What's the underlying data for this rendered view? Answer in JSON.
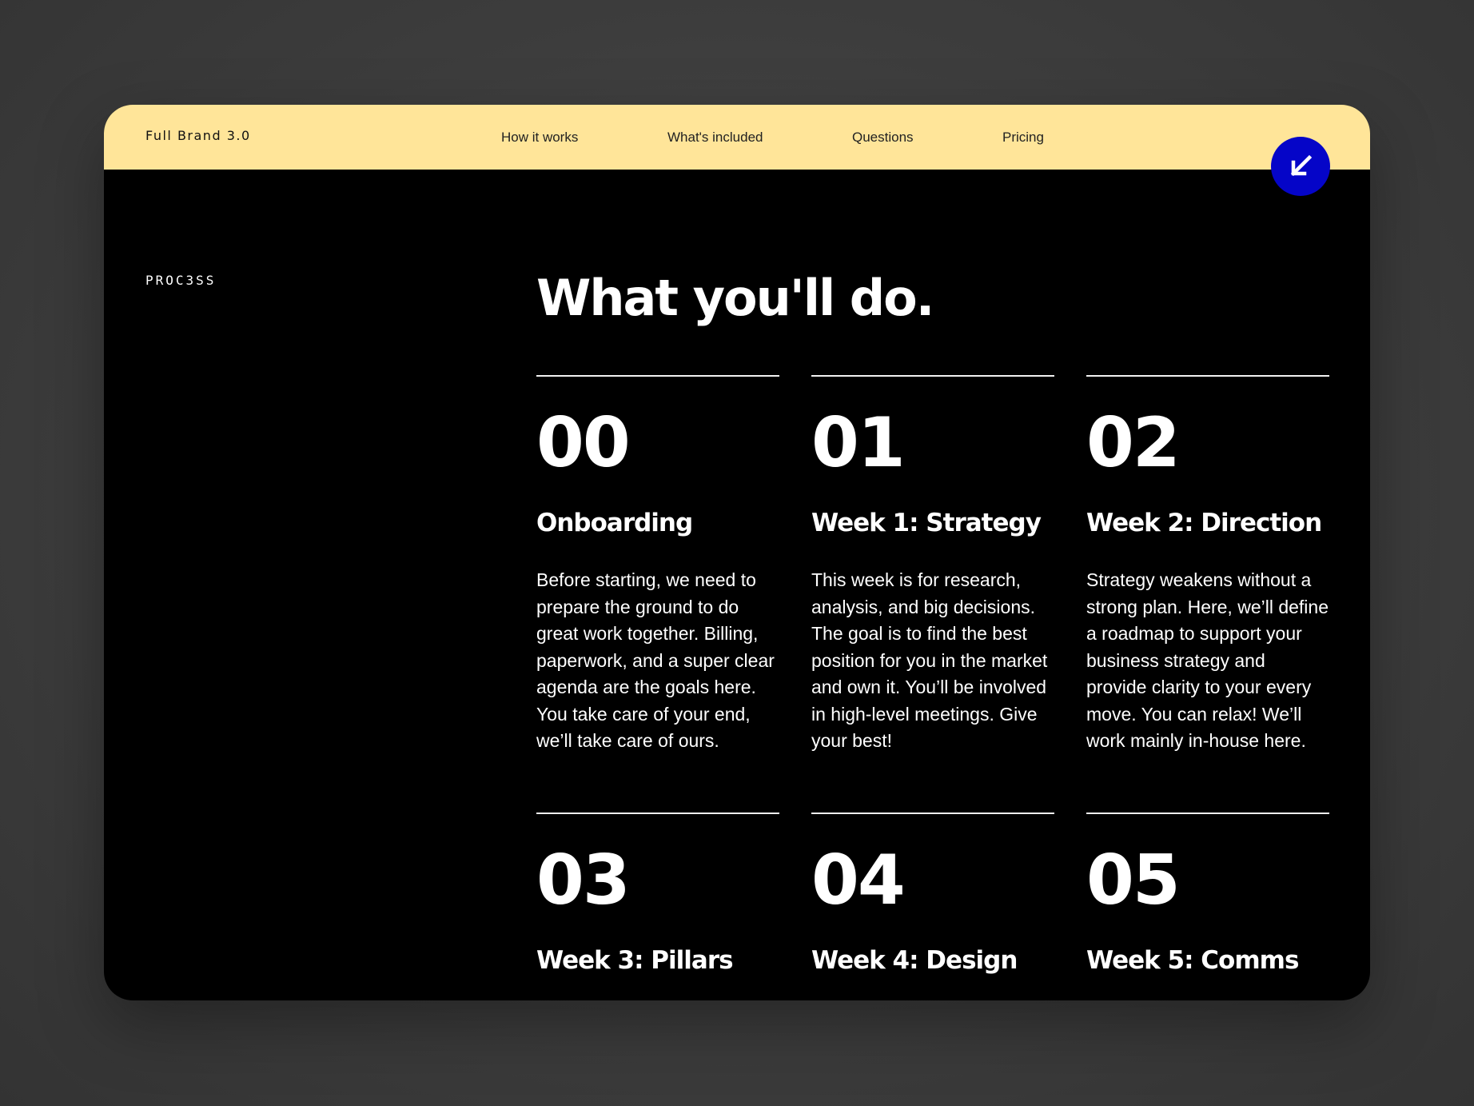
{
  "header": {
    "brand": "Full Brand 3.0",
    "nav": [
      {
        "label": "How it works"
      },
      {
        "label": "What's included"
      },
      {
        "label": "Questions"
      },
      {
        "label": "Pricing"
      }
    ],
    "fab_icon": "arrow-down-left-icon"
  },
  "section": {
    "label": "PROC3SS",
    "headline": "What you'll do."
  },
  "steps": [
    {
      "number": "00",
      "title": "Onboarding",
      "description": "Before starting, we need to prepare the ground to do great work together. Billing, paperwork, and a super clear agenda are the goals here. You take care of your end, we’ll take care of ours."
    },
    {
      "number": "01",
      "title": "Week 1: Strategy",
      "description": "This week is for research, analysis, and big decisions. The goal is to find the best position for you in the market and own it. You’ll be involved in high-level meetings. Give your best!"
    },
    {
      "number": "02",
      "title": "Week 2: Direction",
      "description": "Strategy weakens without a strong plan. Here, we’ll define a roadmap to support your business strategy and provide clarity to your every move. You can relax! We’ll work mainly in-house here."
    },
    {
      "number": "03",
      "title": "Week 3: Pillars",
      "description": ""
    },
    {
      "number": "04",
      "title": "Week 4: Design",
      "description": ""
    },
    {
      "number": "05",
      "title": "Week 5: Comms",
      "description": ""
    }
  ],
  "colors": {
    "topbar": "#ffe599",
    "accent": "#0505c8",
    "panel": "#000000",
    "backdrop": "#3d3d3d"
  }
}
